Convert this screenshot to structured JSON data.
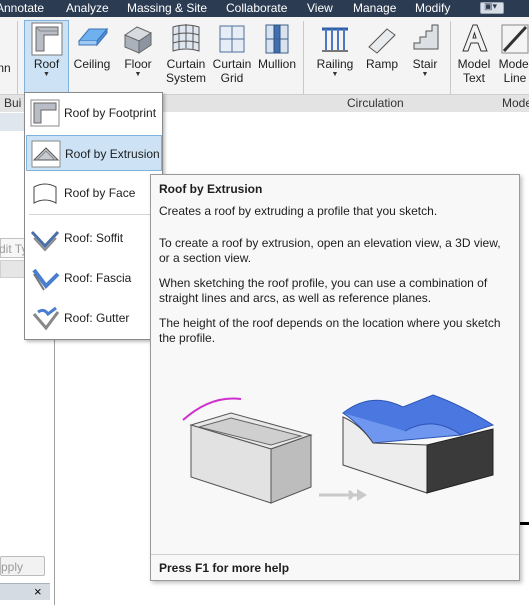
{
  "menu_tabs": [
    "Annotate",
    "Analyze",
    "Massing & Site",
    "Collaborate",
    "View",
    "Manage",
    "Modify"
  ],
  "ribbon": {
    "partial_left_label": "nn",
    "buttons": {
      "roof": "Roof",
      "ceiling": "Ceiling",
      "floor": "Floor",
      "curtain_system": [
        "Curtain",
        "System"
      ],
      "curtain_grid": [
        "Curtain",
        "Grid"
      ],
      "mullion": "Mullion",
      "railing": "Railing",
      "ramp": "Ramp",
      "stair": "Stair",
      "model_text": [
        "Model",
        "Text"
      ],
      "model_line": [
        "Model",
        "Line"
      ]
    },
    "panels": {
      "build": "Bui",
      "circulation": "Circulation",
      "model": "Mode"
    }
  },
  "left_pane": {
    "edit_type_partial": "dit Ty",
    "apply_partial": "pply",
    "close_glyph": "×"
  },
  "roof_menu": {
    "items": [
      {
        "label": "Roof by Footprint",
        "icon": "roof-footprint-icon"
      },
      {
        "label": "Roof by Extrusion",
        "icon": "roof-extrusion-icon",
        "active": true
      },
      {
        "label": "Roof by Face",
        "icon": "roof-face-icon"
      },
      {
        "label": "Roof: Soffit",
        "icon": "roof-soffit-icon"
      },
      {
        "label": "Roof: Fascia",
        "icon": "roof-fascia-icon"
      },
      {
        "label": "Roof: Gutter",
        "icon": "roof-gutter-icon"
      }
    ]
  },
  "tooltip": {
    "title": "Roof by Extrusion",
    "summary": "Creates a roof by extruding a profile that you sketch.",
    "paragraphs": [
      "To create a roof by extrusion, open an elevation view, a 3D view, or a section view.",
      "When sketching the roof profile, you can use a combination of straight lines and arcs, as well as reference planes.",
      "The height of the roof depends on the location where you sketch the profile."
    ],
    "footer": "Press F1 for more help"
  },
  "colors": {
    "menubar_bg": "#2b3b52",
    "ribbon_bg": "#f4f4f4",
    "selection_bg": "#cde3f5",
    "selection_border": "#7fb2dd",
    "roof_blue": "#4b78e0",
    "sketch_magenta": "#d02fd0"
  }
}
